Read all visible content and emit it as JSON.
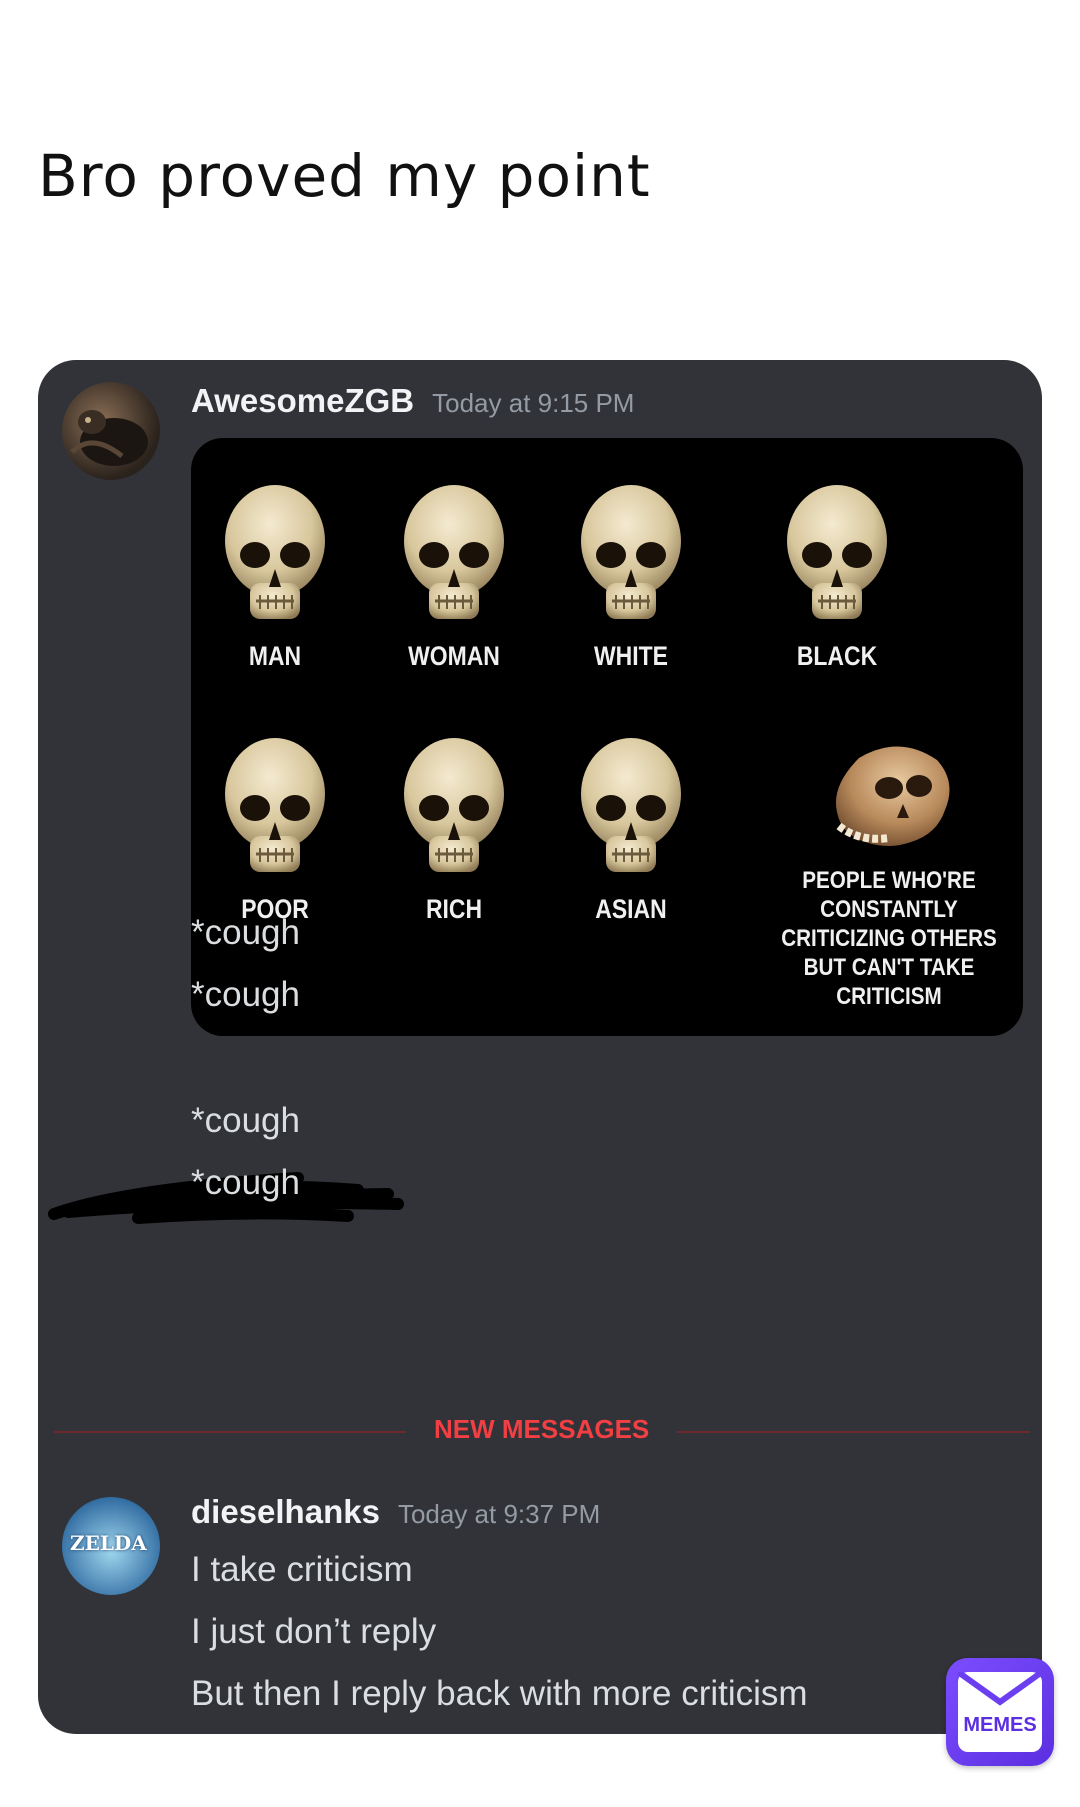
{
  "caption": "Bro proved my point",
  "messages": [
    {
      "username": "AwesomeZGB",
      "timestamp": "Today at 9:15 PM",
      "avatar_icon": "user-avatar-dark",
      "image": {
        "labels": [
          "MAN",
          "WOMAN",
          "WHITE",
          "BLACK",
          "POOR",
          "RICH",
          "ASIAN",
          "PEOPLE WHO'RE CONSTANTLY CRITICIZING OTHERS BUT CAN'T TAKE CRITICISM"
        ]
      },
      "lines": [
        "*cough",
        "*cough",
        "*cough",
        "*cough"
      ]
    },
    {
      "username": "dieselhanks",
      "timestamp": "Today at 9:37 PM",
      "avatar_text": "ZELDA",
      "lines": [
        "I take criticism",
        "I just don’t reply",
        "But then I reply back with more criticism"
      ]
    }
  ],
  "divider_label": "NEW MESSAGES",
  "badge_label": "MEMES",
  "colors": {
    "chat_bg": "#313338",
    "divider_red": "#f23f43",
    "badge_purple": "#5b2fe0"
  }
}
